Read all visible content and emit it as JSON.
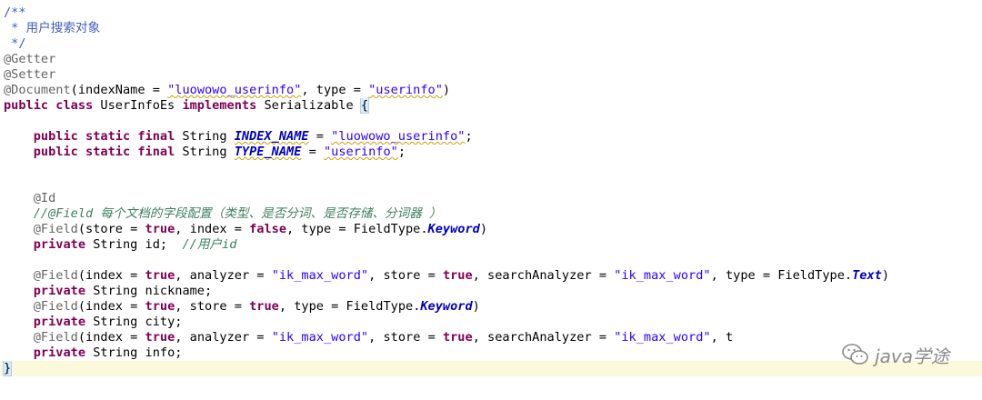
{
  "code_lines": [
    {
      "id": "l1",
      "text": "/**"
    },
    {
      "id": "l2",
      "text": " * 用户搜索对象"
    },
    {
      "id": "l3",
      "text": " */"
    },
    {
      "id": "l4",
      "text": "@Getter"
    },
    {
      "id": "l5",
      "text": "@Setter"
    },
    {
      "id": "l6a",
      "text": "@Document"
    },
    {
      "id": "l6b",
      "text": "(indexName = "
    },
    {
      "id": "l6c",
      "text": "\"luowowo_userinfo\""
    },
    {
      "id": "l6d",
      "text": ", type = "
    },
    {
      "id": "l6e",
      "text": "\"userinfo\""
    },
    {
      "id": "l6f",
      "text": ")"
    },
    {
      "id": "l7a",
      "text": "public class"
    },
    {
      "id": "l7b",
      "text": " UserInfoEs "
    },
    {
      "id": "l7c",
      "text": "implements"
    },
    {
      "id": "l7d",
      "text": " Serializable "
    },
    {
      "id": "l7e",
      "text": "{"
    },
    {
      "id": "l9a",
      "text": "public static final"
    },
    {
      "id": "l9b",
      "text": " String "
    },
    {
      "id": "l9c",
      "text": "INDEX_NAME"
    },
    {
      "id": "l9d",
      "text": " = "
    },
    {
      "id": "l9e",
      "text": "\"luowowo_userinfo\""
    },
    {
      "id": "l9f",
      "text": ";"
    },
    {
      "id": "l10a",
      "text": "public static final"
    },
    {
      "id": "l10b",
      "text": " String "
    },
    {
      "id": "l10c",
      "text": "TYPE_NAME"
    },
    {
      "id": "l10d",
      "text": " = "
    },
    {
      "id": "l10e",
      "text": "\"userinfo\""
    },
    {
      "id": "l10f",
      "text": ";"
    },
    {
      "id": "l13",
      "text": "@Id"
    },
    {
      "id": "l14",
      "text": "//@Field 每个文档的字段配置（类型、是否分词、是否存储、分词器 ）"
    },
    {
      "id": "l15a",
      "text": "@Field"
    },
    {
      "id": "l15b",
      "text": "(store = "
    },
    {
      "id": "l15c",
      "text": "true"
    },
    {
      "id": "l15d",
      "text": ", index = "
    },
    {
      "id": "l15e",
      "text": "false"
    },
    {
      "id": "l15f",
      "text": ", type = FieldType."
    },
    {
      "id": "l15g",
      "text": "Keyword"
    },
    {
      "id": "l15h",
      "text": ")"
    },
    {
      "id": "l16a",
      "text": "private"
    },
    {
      "id": "l16b",
      "text": " String id;  "
    },
    {
      "id": "l16c",
      "text": "//用户id"
    },
    {
      "id": "l18a",
      "text": "@Field"
    },
    {
      "id": "l18b",
      "text": "(index = "
    },
    {
      "id": "l18c",
      "text": "true"
    },
    {
      "id": "l18d",
      "text": ", analyzer = "
    },
    {
      "id": "l18e",
      "text": "\"ik_max_word\""
    },
    {
      "id": "l18f",
      "text": ", store = "
    },
    {
      "id": "l18g",
      "text": "true"
    },
    {
      "id": "l18h",
      "text": ", searchAnalyzer = "
    },
    {
      "id": "l18i",
      "text": "\"ik_max_word\""
    },
    {
      "id": "l18j",
      "text": ", type = FieldType."
    },
    {
      "id": "l18k",
      "text": "Text"
    },
    {
      "id": "l18l",
      "text": ")"
    },
    {
      "id": "l19a",
      "text": "private"
    },
    {
      "id": "l19b",
      "text": " String nickname;"
    },
    {
      "id": "l20a",
      "text": "@Field"
    },
    {
      "id": "l20b",
      "text": "(index = "
    },
    {
      "id": "l20c",
      "text": "true"
    },
    {
      "id": "l20d",
      "text": ", store = "
    },
    {
      "id": "l20e",
      "text": "true"
    },
    {
      "id": "l20f",
      "text": ", type = FieldType."
    },
    {
      "id": "l20g",
      "text": "Keyword"
    },
    {
      "id": "l20h",
      "text": ")"
    },
    {
      "id": "l21a",
      "text": "private"
    },
    {
      "id": "l21b",
      "text": " String city;"
    },
    {
      "id": "l22a",
      "text": "@Field"
    },
    {
      "id": "l22b",
      "text": "(index = "
    },
    {
      "id": "l22c",
      "text": "true"
    },
    {
      "id": "l22d",
      "text": ", analyzer = "
    },
    {
      "id": "l22e",
      "text": "\"ik_max_word\""
    },
    {
      "id": "l22f",
      "text": ", store = "
    },
    {
      "id": "l22g",
      "text": "true"
    },
    {
      "id": "l22h",
      "text": ", searchAnalyzer = "
    },
    {
      "id": "l22i",
      "text": "\"ik_max_word\""
    },
    {
      "id": "l22j",
      "text": ", t"
    },
    {
      "id": "l23a",
      "text": "private"
    },
    {
      "id": "l23b",
      "text": " String info;"
    },
    {
      "id": "l24",
      "text": "}"
    }
  ],
  "watermark": {
    "text": "java学途",
    "icon": "wechat-icon"
  },
  "colors": {
    "keyword": "#7f0055",
    "string": "#2a00ff",
    "annotation": "#646464",
    "comment": "#3f7f5f",
    "javadoc": "#3f5fbf",
    "constant": "#0000c0",
    "current_line": "#fcf8dc"
  }
}
